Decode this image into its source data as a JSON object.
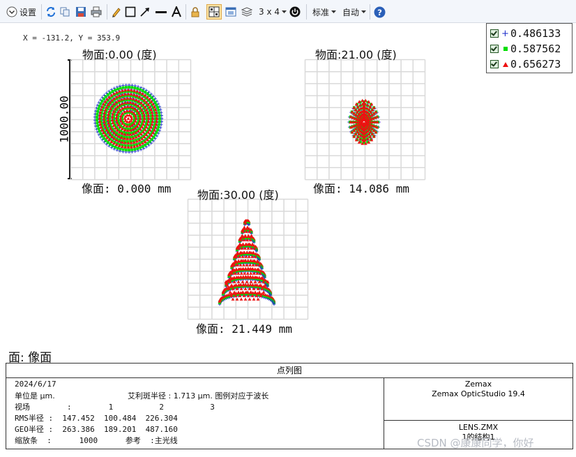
{
  "toolbar": {
    "settings_label": "设置",
    "layout_label": "3 x 4",
    "standard_label": "标准",
    "auto_label": "自动"
  },
  "cursor_readout": "X = -131.2, Y = 353.9",
  "legend": [
    {
      "wavelength": "0.486133",
      "marker": "+",
      "color": "#2233cc"
    },
    {
      "wavelength": "0.587562",
      "marker": "■",
      "color": "#00dd00"
    },
    {
      "wavelength": "0.656273",
      "marker": "▲",
      "color": "#ee1111"
    }
  ],
  "scale_bar_label": "1000.00",
  "plots": [
    {
      "object_label": "物面:0.00 (度)",
      "image_label": "像面: 0.000 mm",
      "pattern": "rings"
    },
    {
      "object_label": "物面:21.00 (度)",
      "image_label": "像面: 14.086 mm",
      "pattern": "lens"
    },
    {
      "object_label": "物面:30.00 (度)",
      "image_label": "像面: 21.449 mm",
      "pattern": "teardrop"
    }
  ],
  "surface_title": "面: 像面",
  "info": {
    "title": "点列图",
    "date": "2024/6/17",
    "unit_line": "单位是 µm.",
    "airy_line": "艾利斑半径 : 1.713 µm. 图例对应于波长",
    "field_line": "视场        :        1          2          3",
    "rms_line": "RMS半径 :  147.452  100.484  226.304",
    "geo_line": "GEO半径 :  263.386  189.201  487.160",
    "scale_line": "缩放条  :      1000      参考  :主光线",
    "software_name": "Zemax",
    "software_version": "Zemax OpticStudio 19.4",
    "file_name": "LENS.ZMX",
    "config_label": "1的结构1"
  },
  "watermark": "CSDN @康康同学，你好",
  "colors": {
    "blue": "#2233cc",
    "green": "#00dd00",
    "red": "#ee1111",
    "grid": "#d9d9d9"
  }
}
